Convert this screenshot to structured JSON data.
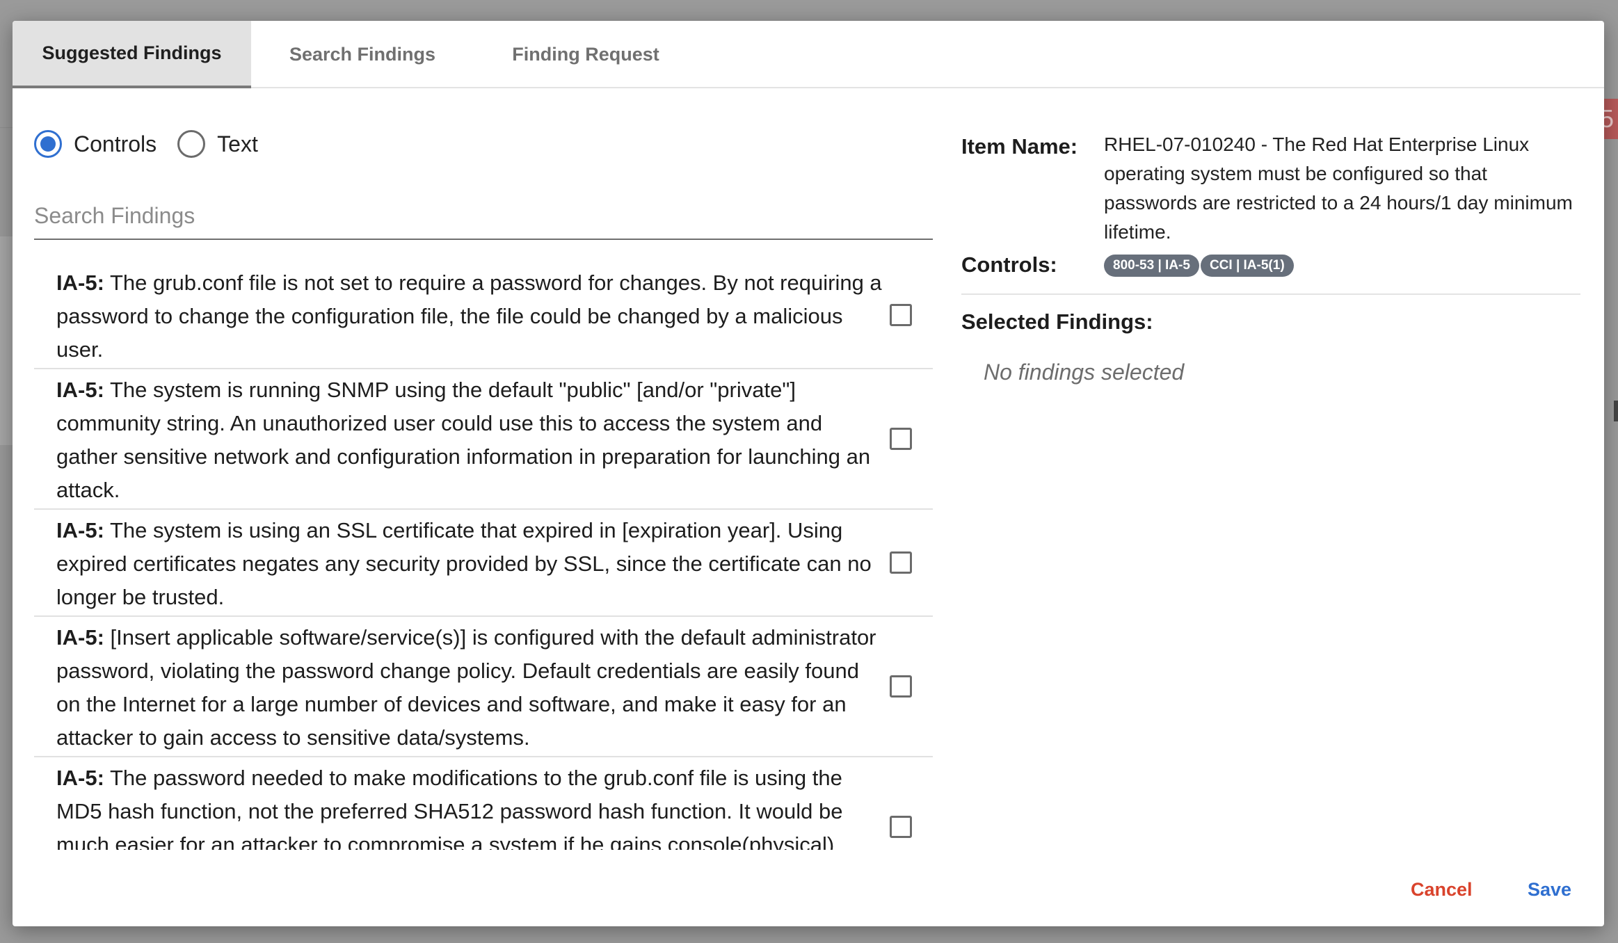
{
  "tabs": [
    {
      "label": "Suggested Findings",
      "active": true
    },
    {
      "label": "Search Findings",
      "active": false
    },
    {
      "label": "Finding Request",
      "active": false
    }
  ],
  "mode": {
    "options": [
      {
        "label": "Controls",
        "checked": true
      },
      {
        "label": "Text",
        "checked": false
      }
    ]
  },
  "search": {
    "placeholder": "Search Findings",
    "value": ""
  },
  "findings": [
    {
      "code": "IA-5:",
      "text": " The grub.conf file is not set to require a password for changes. By not requiring a password to change the configuration file, the file could be changed by a malicious user.",
      "checked": false
    },
    {
      "code": "IA-5:",
      "text": " The system is running SNMP using the default \"public\" [and/or \"private\"] community string. An unauthorized user could use this to access the system and gather sensitive network and configuration information in preparation for launching an attack.",
      "checked": false
    },
    {
      "code": "IA-5:",
      "text": " The system is using an SSL certificate that expired in [expiration year]. Using expired certificates negates any security provided by SSL, since the certificate can no longer be trusted.",
      "checked": false
    },
    {
      "code": "IA-5:",
      "text": " [Insert applicable software/service(s)] is configured with the default administrator password, violating the password change policy. Default credentials are easily found on the Internet for a large number of devices and software, and make it easy for an attacker to gain access to sensitive data/systems.",
      "checked": false
    },
    {
      "code": "IA-5:",
      "text": " The password needed to make modifications to the grub.conf file is using the MD5 hash function, not the preferred SHA512 password hash function. It would be much easier for an attacker to compromise a system if he gains console(physical) access to the system.",
      "checked": false
    }
  ],
  "details": {
    "item_name_label": "Item Name:",
    "item_name_value": "RHEL-07-010240 - The Red Hat Enterprise Linux operating system must be configured so that passwords are restricted to a 24 hours/1 day minimum lifetime.",
    "controls_label": "Controls:",
    "controls": [
      "800-53 | IA-5",
      "CCI | IA-5(1)"
    ],
    "selected_label": "Selected Findings:",
    "selected_empty": "No findings selected"
  },
  "footer": {
    "cancel": "Cancel",
    "save": "Save"
  },
  "colors": {
    "accent": "#2f6fd0",
    "danger": "#d9432c",
    "chip": "#676f7b"
  },
  "background": {
    "badge_text": "5"
  }
}
